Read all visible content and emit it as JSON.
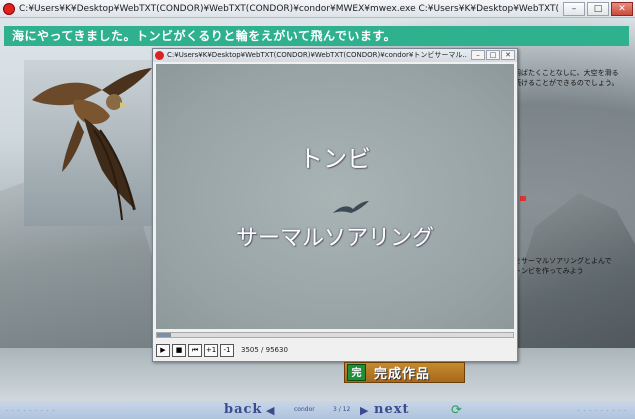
{
  "window": {
    "title": "C:¥Users¥K¥Desktop¥WebTXT(CONDOR)¥WebTXT(CONDOR)¥condor¥MWEX¥mwex.exe C:¥Users¥K¥Desktop¥WebTXT(CONDOR)¥WebTXT(CONDOR)¥condor¥サーマ...",
    "minimize": "–",
    "maximize": "□",
    "close": "✕"
  },
  "header": {
    "text": "海にやってきました。トンビがくるりと輪をえがいて飛んでいます。"
  },
  "side_text": {
    "line1": "羽ばたくことなしに、大空を滑る",
    "line2": "続けることができるのでしょう。",
    "line3": "をサーマルソアリングとよんで",
    "line4": "トンビを作ってみよう"
  },
  "player": {
    "title": "C:¥Users¥K¥Desktop¥WebTXT(CONDOR)¥WebTXT(CONDOR)¥condor¥トンビサーマル...",
    "video_title_1": "トンビ",
    "video_title_2": "サーマルソアリング",
    "controls": {
      "play": "▶",
      "stop": "■",
      "rewind": "⏮",
      "plus_one": "+1",
      "minus_one": "-1"
    },
    "frame_counter": "3505 / 95630",
    "progress": 0.04
  },
  "works_button": {
    "badge": "完",
    "label": "完成作品"
  },
  "nav": {
    "back": "back",
    "next": "next",
    "section": "condor",
    "page": "3 / 12",
    "dots": "· · · · · · · · ·"
  }
}
